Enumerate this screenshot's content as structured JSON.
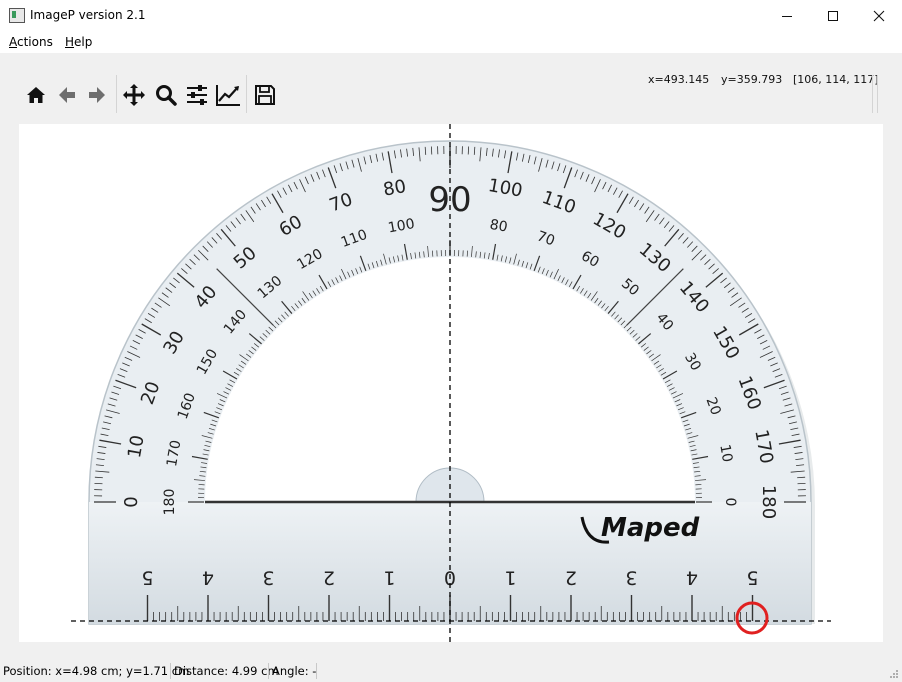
{
  "window": {
    "title": "ImageP version 2.1",
    "controls": [
      "minimize",
      "maximize",
      "close"
    ]
  },
  "menu": {
    "actions": {
      "accel": "A",
      "rest": "ctions"
    },
    "help": {
      "accel": "H",
      "rest": "elp"
    }
  },
  "toolbar": {
    "icons": [
      "home-icon",
      "back-arrow-icon",
      "forward-arrow-icon",
      "pan-icon",
      "zoom-icon",
      "subplots-icon",
      "edit-axis-icon",
      "save-icon"
    ],
    "coord_x": "x=493.145",
    "coord_y": "y=359.793",
    "pixel_value": "[106, 114, 117]"
  },
  "image": {
    "brand": "Maped",
    "center_label": "90",
    "outer_labels": [
      "0",
      "10",
      "20",
      "30",
      "40",
      "50",
      "60",
      "70",
      "80",
      "100",
      "110",
      "120",
      "130",
      "140",
      "150",
      "160",
      "170",
      "180"
    ],
    "inner_labels": [
      "180",
      "170",
      "160",
      "150",
      "140",
      "130",
      "120",
      "110",
      "100",
      "80",
      "70",
      "60",
      "50",
      "40",
      "30",
      "20",
      "10",
      "0"
    ],
    "ruler_labels": [
      "5",
      "4",
      "3",
      "2",
      "1",
      "0",
      "1",
      "2",
      "3",
      "4",
      "5"
    ],
    "marker_color": "#e02020"
  },
  "status": {
    "position": "Position: x=4.98 cm; y=1.71 cm",
    "distance": "Distance: 4.99 cm",
    "angle": "Angle: -"
  }
}
